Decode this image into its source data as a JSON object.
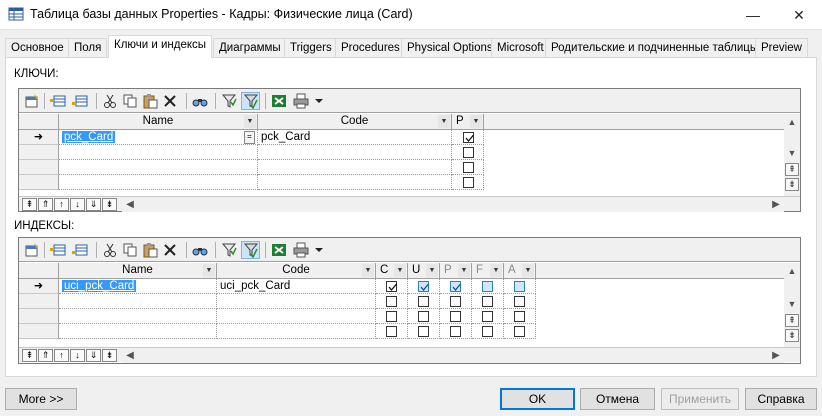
{
  "window": {
    "title": "Таблица базы данных Properties - Кадры: Физические лица (Card)",
    "minimize_glyph": "—",
    "close_glyph": "✕"
  },
  "tabs": [
    {
      "label": "Основное"
    },
    {
      "label": "Поля"
    },
    {
      "label": "Ключи и индексы",
      "active": true
    },
    {
      "label": "Диаграммы"
    },
    {
      "label": "Triggers"
    },
    {
      "label": "Procedures"
    },
    {
      "label": "Physical Options"
    },
    {
      "label": "Microsoft"
    },
    {
      "label": "Родительские и подчиненные таблицы"
    },
    {
      "label": "Preview"
    }
  ],
  "keys_section": {
    "label": "КЛЮЧИ:",
    "toolbar_icons": [
      "properties-icon",
      "add-row-icon",
      "insert-row-icon",
      "cut-icon",
      "copy-icon",
      "paste-icon",
      "delete-icon",
      "find-icon",
      "filter-icon",
      "customize-columns-icon",
      "excel-export-icon",
      "print-icon",
      "dropdown-arrow-icon"
    ],
    "columns": {
      "name": "Name",
      "code": "Code",
      "p": "P"
    },
    "rows": [
      {
        "current": true,
        "name": "pck_Card",
        "code": "pck_Card",
        "p": true
      },
      {
        "name": "",
        "code": "",
        "p": false
      },
      {
        "name": "",
        "code": "",
        "p": false
      },
      {
        "name": "",
        "code": "",
        "p": false
      }
    ],
    "combo_glyph": "="
  },
  "indexes_section": {
    "label": "ИНДЕКСЫ:",
    "columns": {
      "name": "Name",
      "code": "Code",
      "c": "C",
      "u": "U",
      "p": "P",
      "f": "F",
      "a": "A"
    },
    "rows": [
      {
        "current": true,
        "name": "uci_pck_Card",
        "code": "uci_pck_Card",
        "c": true,
        "u": true,
        "p": true,
        "f": false,
        "a": false
      },
      {
        "name": "",
        "code": "",
        "c": false,
        "u": false,
        "p": false,
        "f": false,
        "a": false
      },
      {
        "name": "",
        "code": "",
        "c": false,
        "u": false,
        "p": false,
        "f": false,
        "a": false
      },
      {
        "name": "",
        "code": "",
        "c": false,
        "u": false,
        "p": false,
        "f": false,
        "a": false
      }
    ]
  },
  "row_pointer_glyph": "➜",
  "nav_glyphs": [
    "⇞",
    "⇑",
    "↑",
    "↓",
    "⇓",
    "⇟"
  ],
  "buttons": {
    "more": "More >>",
    "ok": "OK",
    "cancel": "Отмена",
    "apply": "Применить",
    "help": "Справка"
  },
  "colors": {
    "selection": "#3399ff",
    "accent": "#0078d7"
  }
}
